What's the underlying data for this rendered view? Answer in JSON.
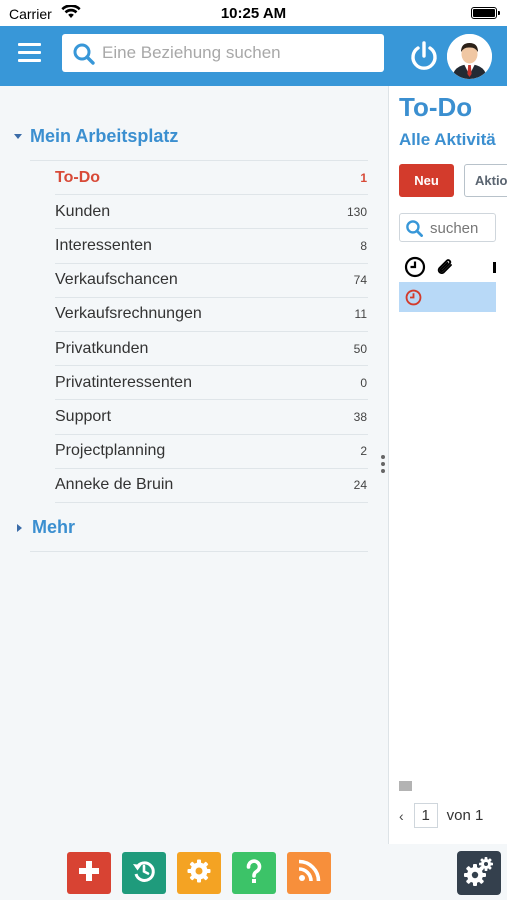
{
  "status_bar": {
    "carrier": "Carrier",
    "time": "10:25 AM"
  },
  "header": {
    "search_placeholder": "Eine Beziehung suchen",
    "icons": [
      "menu-icon",
      "search-icon",
      "power-icon",
      "avatar"
    ]
  },
  "workspace": {
    "title": "Mein Arbeitsplatz",
    "items": [
      {
        "label": "To-Do",
        "count": "1",
        "active": true
      },
      {
        "label": "Kunden",
        "count": "130"
      },
      {
        "label": "Interessenten",
        "count": "8"
      },
      {
        "label": "Verkaufschancen",
        "count": "74"
      },
      {
        "label": "Verkaufsrechnungen",
        "count": "11"
      },
      {
        "label": "Privatkunden",
        "count": "50"
      },
      {
        "label": "Privatinteressenten",
        "count": "0"
      },
      {
        "label": "Support",
        "count": "38"
      },
      {
        "label": "Projectplanning",
        "count": "2"
      },
      {
        "label": "Anneke de Bruin",
        "count": "24"
      }
    ],
    "more_label": "Mehr"
  },
  "panel": {
    "title": "To-Do",
    "subtitle": "Alle Aktivitä",
    "new_button": "Neu",
    "actions_button": "Aktio",
    "search_placeholder": "suchen",
    "pager": {
      "current_page": "1",
      "of_text": "von 1"
    }
  },
  "toolbar": {
    "buttons": [
      "add-icon",
      "history-icon",
      "settings-icon",
      "help-icon",
      "rss-icon",
      "admin-settings-icon"
    ]
  },
  "colors": {
    "header_blue": "#3897d8",
    "accent_blue": "#3b8fd0",
    "active_red": "#d84a38",
    "new_button_red": "#d33b2c",
    "selected_row": "#b8d9f7",
    "add_red": "#d84333",
    "history_green": "#1f9b7c",
    "settings_orange": "#f4a323",
    "help_green": "#3cc368",
    "rss_orange": "#f78f3b",
    "admin_dark": "#34404d"
  }
}
